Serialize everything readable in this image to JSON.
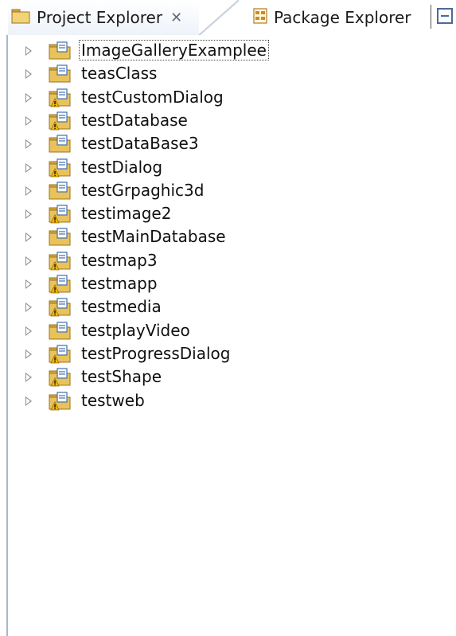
{
  "tabs": {
    "project_explorer": "Project Explorer",
    "close_symbol": "✕",
    "package_explorer": "Package Explorer"
  },
  "projects": [
    {
      "label": "ImageGalleryExamplee",
      "warning": false,
      "selected": true
    },
    {
      "label": "teasClass",
      "warning": false,
      "selected": false
    },
    {
      "label": "testCustomDialog",
      "warning": true,
      "selected": false
    },
    {
      "label": "testDatabase",
      "warning": true,
      "selected": false
    },
    {
      "label": "testDataBase3",
      "warning": false,
      "selected": false
    },
    {
      "label": "testDialog",
      "warning": true,
      "selected": false
    },
    {
      "label": "testGrpaghic3d",
      "warning": false,
      "selected": false
    },
    {
      "label": "testimage2",
      "warning": true,
      "selected": false
    },
    {
      "label": "testMainDatabase",
      "warning": false,
      "selected": false
    },
    {
      "label": "testmap3",
      "warning": true,
      "selected": false
    },
    {
      "label": "testmapp",
      "warning": true,
      "selected": false
    },
    {
      "label": "testmedia",
      "warning": true,
      "selected": false
    },
    {
      "label": "testplayVideo",
      "warning": false,
      "selected": false
    },
    {
      "label": "testProgressDialog",
      "warning": true,
      "selected": false
    },
    {
      "label": "testShape",
      "warning": true,
      "selected": false
    },
    {
      "label": "testweb",
      "warning": true,
      "selected": false
    }
  ],
  "icons": {
    "project": "project-folder-icon",
    "warning": "warning-overlay-icon",
    "expander": "expand-arrow-icon",
    "project_explorer": "project-explorer-icon",
    "package_explorer": "package-explorer-icon",
    "view_menu": "minimize-view-icon"
  },
  "colors": {
    "folder": "#e9c25a",
    "warning": "#f5b600",
    "tab_border": "#a9b7cb"
  }
}
